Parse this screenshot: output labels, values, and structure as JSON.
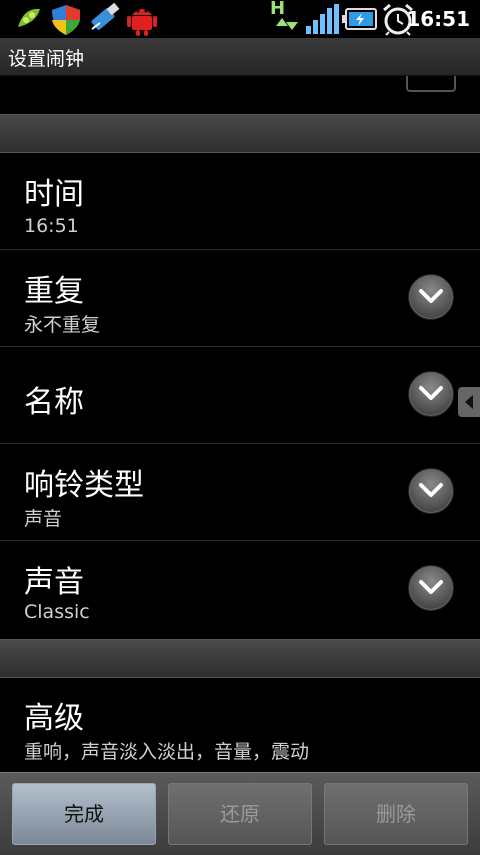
{
  "status_bar": {
    "time": "16:51",
    "network_type": "H",
    "icons": [
      "peapod-icon",
      "shield-icon",
      "usb-icon",
      "android-debug-icon",
      "network-activity-icon",
      "signal-icon",
      "battery-charging-icon",
      "alarm-clock-icon"
    ],
    "colors": {
      "peapod": "#7fbf2a",
      "android": "#e02020",
      "usb": "#3a8fdc",
      "signal": "#6ec0ff",
      "network": "#9be27a"
    }
  },
  "title_bar": {
    "title": "设置闹钟"
  },
  "prefs": {
    "time": {
      "title": "时间",
      "summary": "16:51"
    },
    "repeat": {
      "title": "重复",
      "summary": "永不重复"
    },
    "name": {
      "title": "名称"
    },
    "ring_type": {
      "title": "响铃类型",
      "summary": "声音"
    },
    "sound": {
      "title": "声音",
      "summary": "Classic"
    },
    "advanced": {
      "title": "高级",
      "summary": "重响，声音淡入淡出，音量，震动"
    }
  },
  "buttons": {
    "done": "完成",
    "revert": "还原",
    "delete": "删除"
  }
}
